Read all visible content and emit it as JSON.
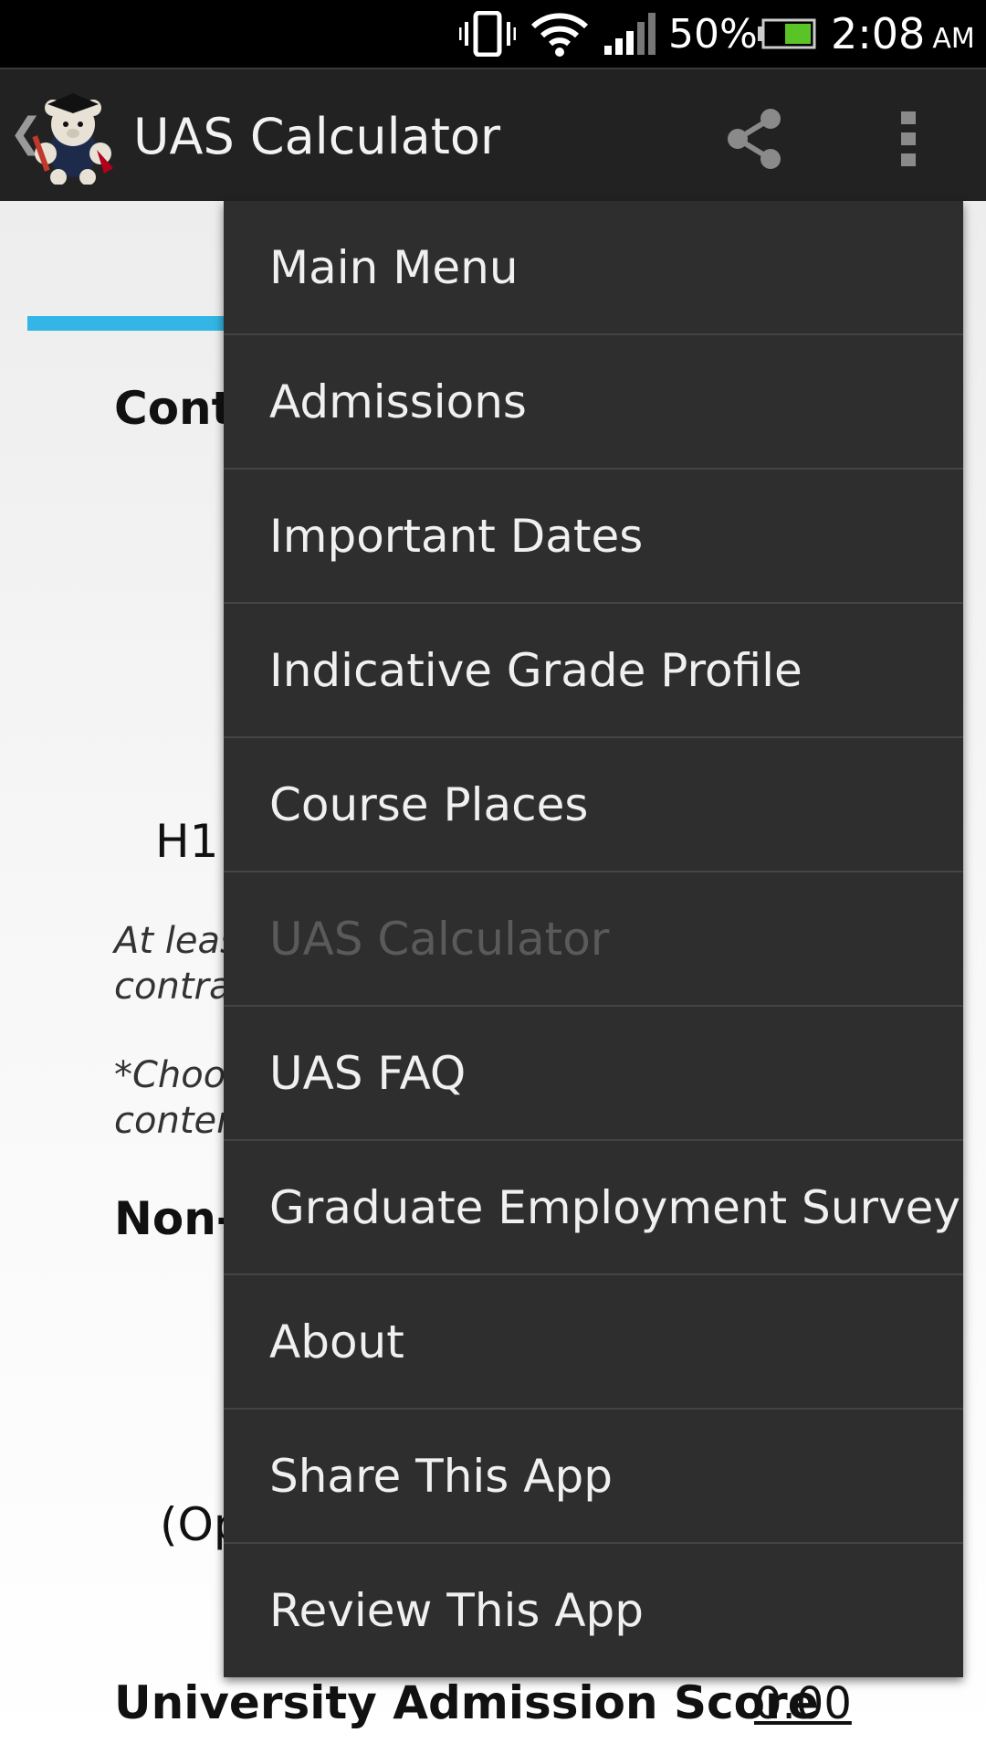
{
  "status_bar": {
    "battery_percent": "50%",
    "time": "2:08",
    "ampm": "AM",
    "icons": [
      "vibrate-icon",
      "wifi-icon",
      "signal-icon",
      "battery-icon"
    ]
  },
  "action_bar": {
    "title": "UAS Calculator",
    "back_glyph": "❮",
    "icons": [
      "app-logo-icon",
      "share-icon",
      "overflow-menu-icon"
    ]
  },
  "page": {
    "section_heading_partial": "Conte",
    "h1_partial": "H1",
    "note1_line1": "At leas",
    "note1_line2": "contra",
    "note2_line1": "*Choos",
    "note2_line2": "conten",
    "section2_heading_partial": "Non-",
    "optional_partial": "(Op",
    "uas_label": "University Admission Score",
    "uas_value": "0.00"
  },
  "menu": {
    "items": [
      {
        "label": "Main Menu",
        "enabled": true
      },
      {
        "label": "Admissions",
        "enabled": true
      },
      {
        "label": "Important Dates",
        "enabled": true
      },
      {
        "label": "Indicative Grade Profile",
        "enabled": true
      },
      {
        "label": "Course Places",
        "enabled": true
      },
      {
        "label": "UAS Calculator",
        "enabled": false
      },
      {
        "label": "UAS FAQ",
        "enabled": true
      },
      {
        "label": "Graduate Employment Survey",
        "enabled": true
      },
      {
        "label": "About",
        "enabled": true
      },
      {
        "label": "Share This App",
        "enabled": true
      },
      {
        "label": "Review This App",
        "enabled": true
      }
    ]
  },
  "colors": {
    "tab_indicator": "#33b5e5",
    "menu_background": "#2e2e2e",
    "action_bar_background": "#222222",
    "disabled_text": "#5a5a5a"
  }
}
